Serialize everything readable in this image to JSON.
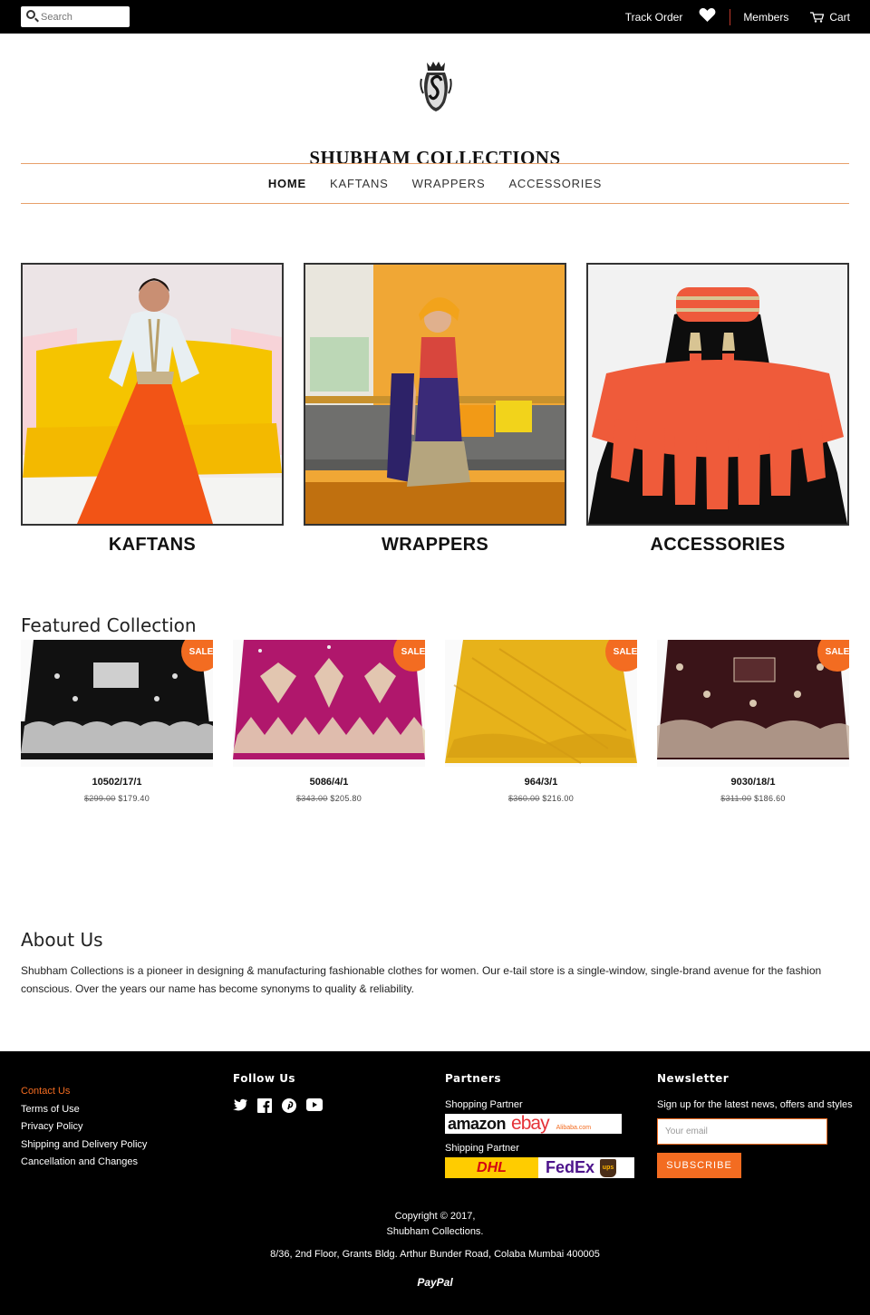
{
  "topbar": {
    "search_placeholder": "Search",
    "track_order": "Track Order",
    "members": "Members",
    "cart": "Cart"
  },
  "brand": {
    "name": "SHUBHAM COLLECTIONS"
  },
  "nav": {
    "items": [
      {
        "label": "HOME"
      },
      {
        "label": "KAFTANS"
      },
      {
        "label": "WRAPPERS"
      },
      {
        "label": "ACCESSORIES"
      }
    ]
  },
  "categories": [
    {
      "label": "KAFTANS"
    },
    {
      "label": "WRAPPERS"
    },
    {
      "label": "ACCESSORIES"
    }
  ],
  "featured": {
    "title": "Featured Collection",
    "badge": "SALE",
    "products": [
      {
        "name": "10502/17/1",
        "old_price": "$299.00",
        "price": "$179.40"
      },
      {
        "name": "5086/4/1",
        "old_price": "$343.00",
        "price": "$205.80"
      },
      {
        "name": "964/3/1",
        "old_price": "$360.00",
        "price": "$216.00"
      },
      {
        "name": "9030/18/1",
        "old_price": "$311.00",
        "price": "$186.60"
      }
    ]
  },
  "about": {
    "title": "About Us",
    "text": "Shubham Collections is a pioneer in designing & manufacturing fashionable clothes for women. Our e-tail store is a single-window, single-brand avenue for the fashion conscious. Over the years our name has become synonyms to quality & reliability."
  },
  "footer": {
    "links": [
      "Contact Us",
      "Terms of Use",
      "Privacy Policy",
      "Shipping and Delivery Policy",
      "Cancellation and Changes"
    ],
    "follow_title": "Follow Us",
    "partners_title": "Partners",
    "shopping_partner": "Shopping Partner",
    "shipping_partner": "Shipping Partner",
    "shopping_logos": [
      "amazon",
      "ebay",
      "Alibaba.com"
    ],
    "shipping_logos": [
      "DHL",
      "FedEx",
      "ups"
    ],
    "newsletter_title": "Newsletter",
    "newsletter_text": "Sign up for the latest news, offers and styles",
    "email_placeholder": "Your email",
    "subscribe": "SUBSCRIBE",
    "copyright": "Copyright © 2017,",
    "company": "Shubham Collections.",
    "address": "8/36, 2nd Floor, Grants Bldg. Arthur Bunder Road, Colaba Mumbai 400005",
    "payment": "PayPal"
  },
  "colors": {
    "accent": "#f36c21",
    "nav_border": "#e8a06a",
    "topbar": "#000000"
  }
}
